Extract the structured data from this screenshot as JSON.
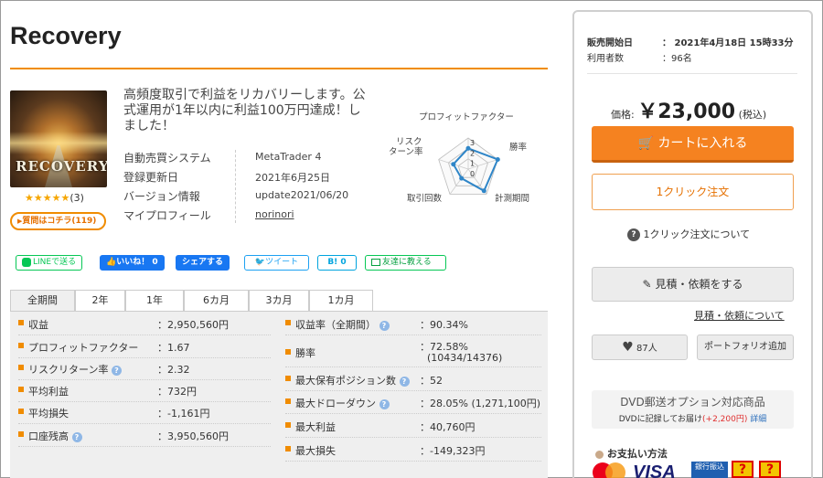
{
  "product": {
    "title": "Recovery",
    "thumbnail_text": "RECOVERY",
    "rating_stars": "★★★★★",
    "rating_count": "(3)",
    "question_button": "質問はコチラ(119)",
    "description": "高頻度取引で利益をリカバリーします。公式運用が1年以内に利益100万円達成！しました！",
    "info": [
      {
        "label": "自動売買システム",
        "value": "MetaTrader 4"
      },
      {
        "label": "登録更新日",
        "value": "2021年6月25日"
      },
      {
        "label": "バージョン情報",
        "value": "update2021/06/20"
      },
      {
        "label": "マイプロフィール",
        "value": "norinori"
      }
    ]
  },
  "radar": {
    "labels": [
      "プロフィットファクター",
      "勝率",
      "計測期間",
      "取引回数",
      "リスク\nターン率"
    ],
    "label_top": "プロフィットファクター",
    "label_right": "勝率",
    "label_bottom_right": "計測期間",
    "label_bottom_left": "取引回数",
    "label_left_1": "リスク",
    "label_left_2": "ターン率",
    "scale_labels": [
      "3",
      "2",
      "1",
      "0"
    ],
    "values": [
      2.0,
      3.0,
      2.6,
      1.1,
      1.5
    ],
    "max": 3
  },
  "share": {
    "line": "LINEで送る",
    "like": "いいね！ 0",
    "fb_share": "シェアする",
    "tweet": "ツイート",
    "hatena": "B! 0",
    "mail": "友達に教える"
  },
  "period_tabs": [
    "全期間",
    "2年",
    "1年",
    "6カ月",
    "3カ月",
    "1カ月"
  ],
  "stats_left": [
    {
      "label": "収益",
      "value": "：2,950,560円",
      "help": false
    },
    {
      "label": "プロフィットファクター",
      "value": "：1.67",
      "help": false
    },
    {
      "label": "リスクリターン率",
      "value": "：2.32",
      "help": true
    },
    {
      "label": "平均利益",
      "value": "：732円",
      "help": false
    },
    {
      "label": "平均損失",
      "value": "：-1,161円",
      "help": false
    },
    {
      "label": "口座残高",
      "value": "：3,950,560円",
      "help": true
    }
  ],
  "stats_right": [
    {
      "label": "収益率（全期間）",
      "value": "：90.34%",
      "help": true
    },
    {
      "label": "勝率",
      "value": "：72.58%",
      "value2": "(10434/14376)",
      "help": false
    },
    {
      "label": "最大保有ポジション数",
      "value": "：52",
      "help": true
    },
    {
      "label": "最大ドローダウン",
      "value": "：28.05% (1,271,100円)",
      "help": true
    },
    {
      "label": "最大利益",
      "value": "：40,760円",
      "help": false
    },
    {
      "label": "最大損失",
      "value": "：-149,323円",
      "help": false
    }
  ],
  "sidebar": {
    "release_label": "販売開始日",
    "release_value": "：  2021年4月18日 15時33分",
    "users_label": "利用者数",
    "users_value": "：96名",
    "price_label": "価格:",
    "price_value": "￥23,000",
    "tax_note": "(税込)",
    "cart_button": "カートに入れる",
    "oneclick_button": "1クリック注文",
    "oneclick_about": "1クリック注文について",
    "quote_button": "見積・依頼をする",
    "quote_about": "見積・依頼について",
    "favorite_count": "87人",
    "portfolio_button": "ポートフォリオ追加",
    "dvd_title": "DVD郵送オプション対応商品",
    "dvd_note": "DVDに記録してお届け",
    "dvd_price": "(+2,200円)",
    "dvd_detail": "詳細",
    "payment_title": "お支払い方法",
    "payment_visa": "VISA",
    "payment_bank": "銀行振込",
    "payment_q": "?"
  },
  "colors": {
    "accent": "#f58220",
    "rule": "#f08c00",
    "star": "#f6a600",
    "radar_line": "#2f86c8",
    "line_green": "#06c755",
    "facebook": "#1877f2",
    "twitter": "#1da1f2",
    "hatena": "#00a4de",
    "help": "#8fb7e6"
  }
}
